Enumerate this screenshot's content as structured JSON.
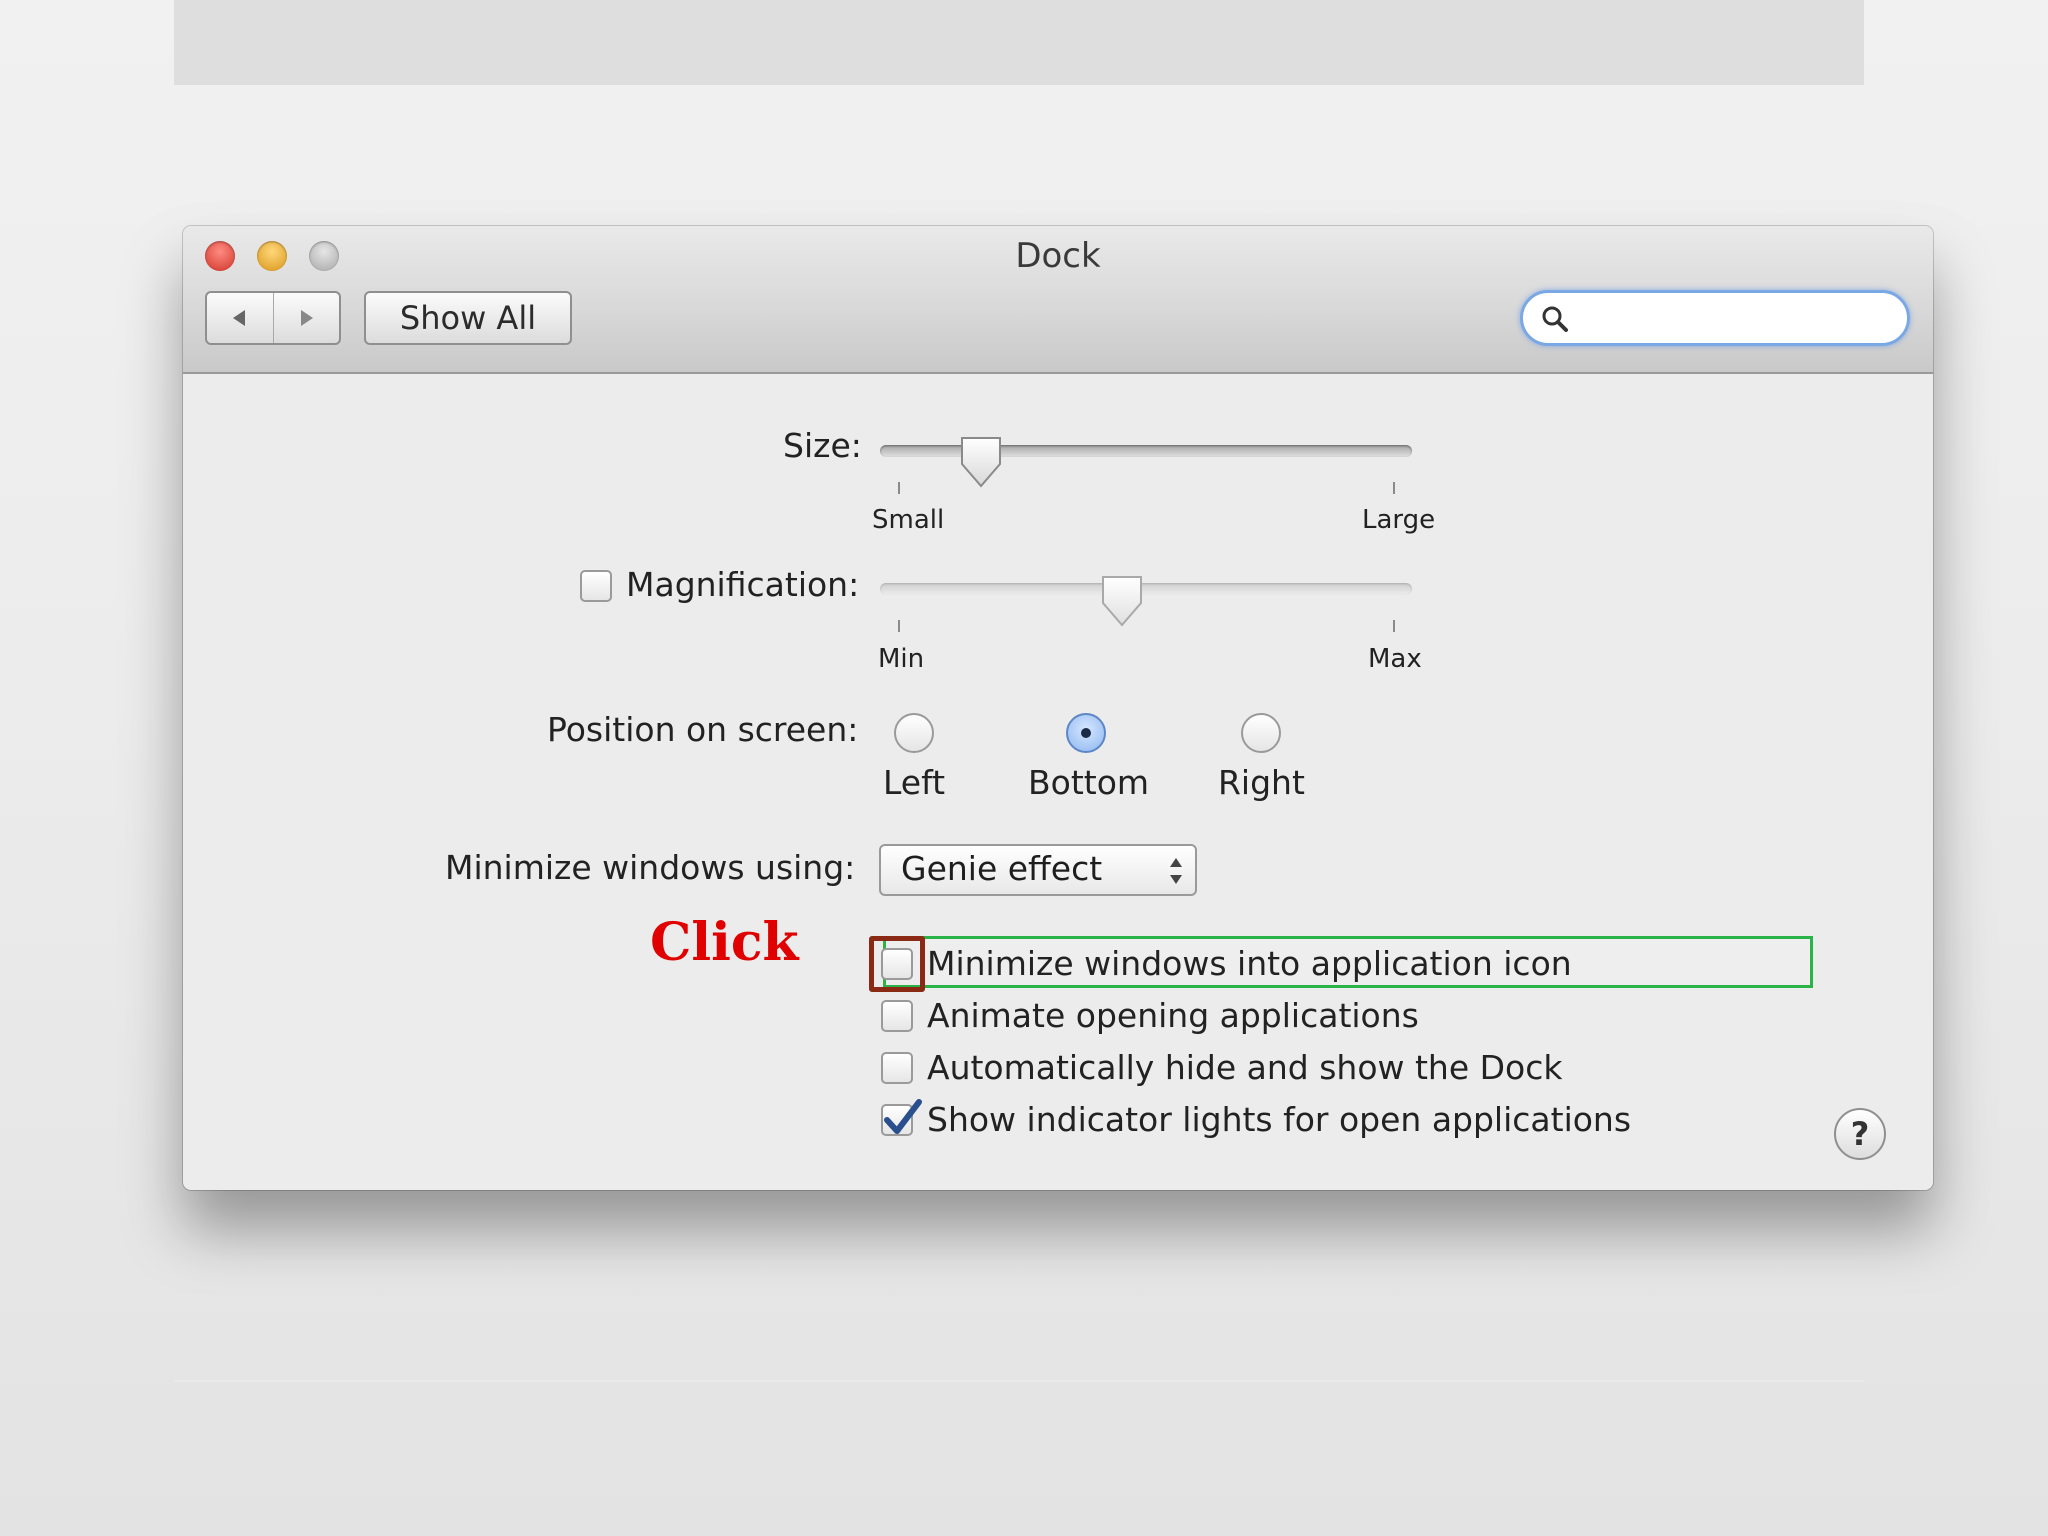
{
  "window": {
    "title": "Dock"
  },
  "toolbar": {
    "back_icon": "back-arrow-icon",
    "forward_icon": "forward-arrow-icon",
    "show_all_label": "Show All",
    "search_value": "",
    "search_placeholder": ""
  },
  "size": {
    "label": "Size:",
    "min_label": "Small",
    "max_label": "Large",
    "level": 0.16
  },
  "magnification": {
    "label": "Magnification:",
    "checked": false,
    "min_label": "Min",
    "max_label": "Max",
    "level": 0.45
  },
  "position": {
    "label": "Position on screen:",
    "options": [
      {
        "label": "Left",
        "selected": false
      },
      {
        "label": "Bottom",
        "selected": true
      },
      {
        "label": "Right",
        "selected": false
      }
    ]
  },
  "minimize": {
    "label": "Minimize windows using:",
    "selected_value": "Genie effect"
  },
  "options": [
    {
      "label": "Minimize windows into application icon",
      "checked": false
    },
    {
      "label": "Animate opening applications",
      "checked": false
    },
    {
      "label": "Automatically hide and show the Dock",
      "checked": false
    },
    {
      "label": "Show indicator lights for open applications",
      "checked": true
    }
  ],
  "help_label": "?",
  "annotation": {
    "text": "Click",
    "color": "#e00000",
    "highlight_row_color": "#2bb34a",
    "highlight_checkbox_color": "#8b2a14"
  }
}
